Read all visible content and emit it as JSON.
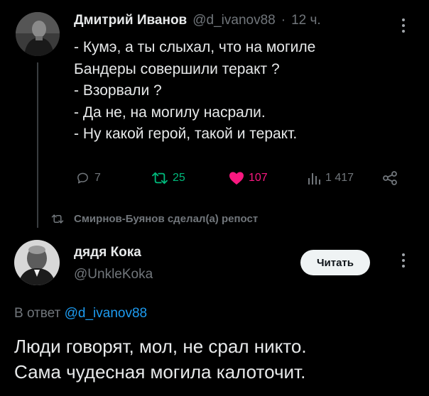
{
  "tweet1": {
    "author": "Дмитрий Иванов",
    "handle": "@d_ivanov88",
    "separator": "·",
    "time": "12 ч.",
    "lines": [
      "- Кумэ, а ты слыхал, что на могиле",
      "Бандеры совершили теракт ?",
      "- Взорвали ?",
      "- Да не, на могилу насрали.",
      "- Ну какой герой, такой и теракт."
    ],
    "actions": {
      "replies": "7",
      "reposts": "25",
      "likes": "107",
      "views": "1 417"
    },
    "colors": {
      "reposted": "#00ba7c",
      "liked": "#f91880",
      "muted": "#71767b"
    }
  },
  "repost_label": "Смирнов-Буянов сделал(а) репост",
  "tweet2": {
    "author": "дядя Кока",
    "handle": "@UnkleKoka",
    "follow_label": "Читать",
    "reply_prefix": "В ответ",
    "reply_handle": "@d_ivanov88",
    "lines": [
      "Люди говорят, мол, не срал никто.",
      "Сама чудесная могила калоточит."
    ]
  },
  "icons": {
    "more": "more-vertical-icon",
    "reply": "comment-icon",
    "repost": "repost-icon",
    "like": "heart-icon",
    "views": "analytics-icon",
    "share": "share-icon"
  }
}
